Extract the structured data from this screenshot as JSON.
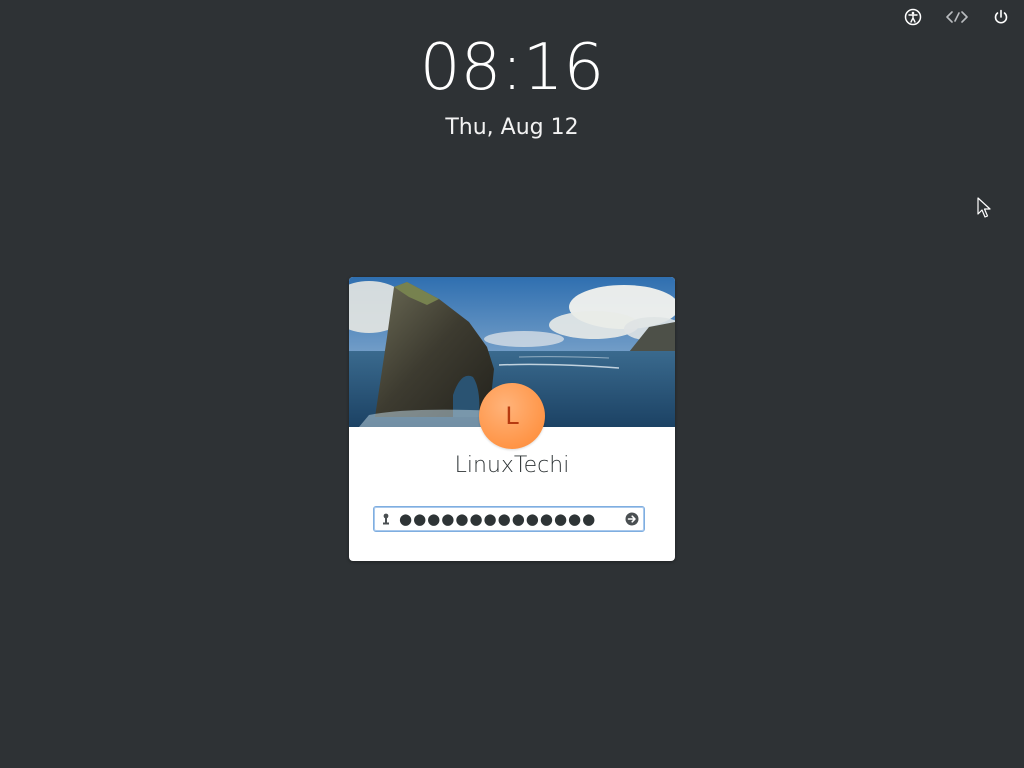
{
  "clock": {
    "time": "08:16",
    "date": "Thu, Aug 12"
  },
  "top_bar": {
    "icons": [
      "accessibility-icon",
      "network-disconnected-icon",
      "power-icon"
    ]
  },
  "login": {
    "username": "LinuxTechi",
    "avatar_initial": "L",
    "password_value": "●●●●●●●●●●●●●●",
    "avatar_color": "#ff9547",
    "focus_color": "#7faee0"
  },
  "colors": {
    "background": "#2e3235",
    "card": "#ffffff"
  }
}
